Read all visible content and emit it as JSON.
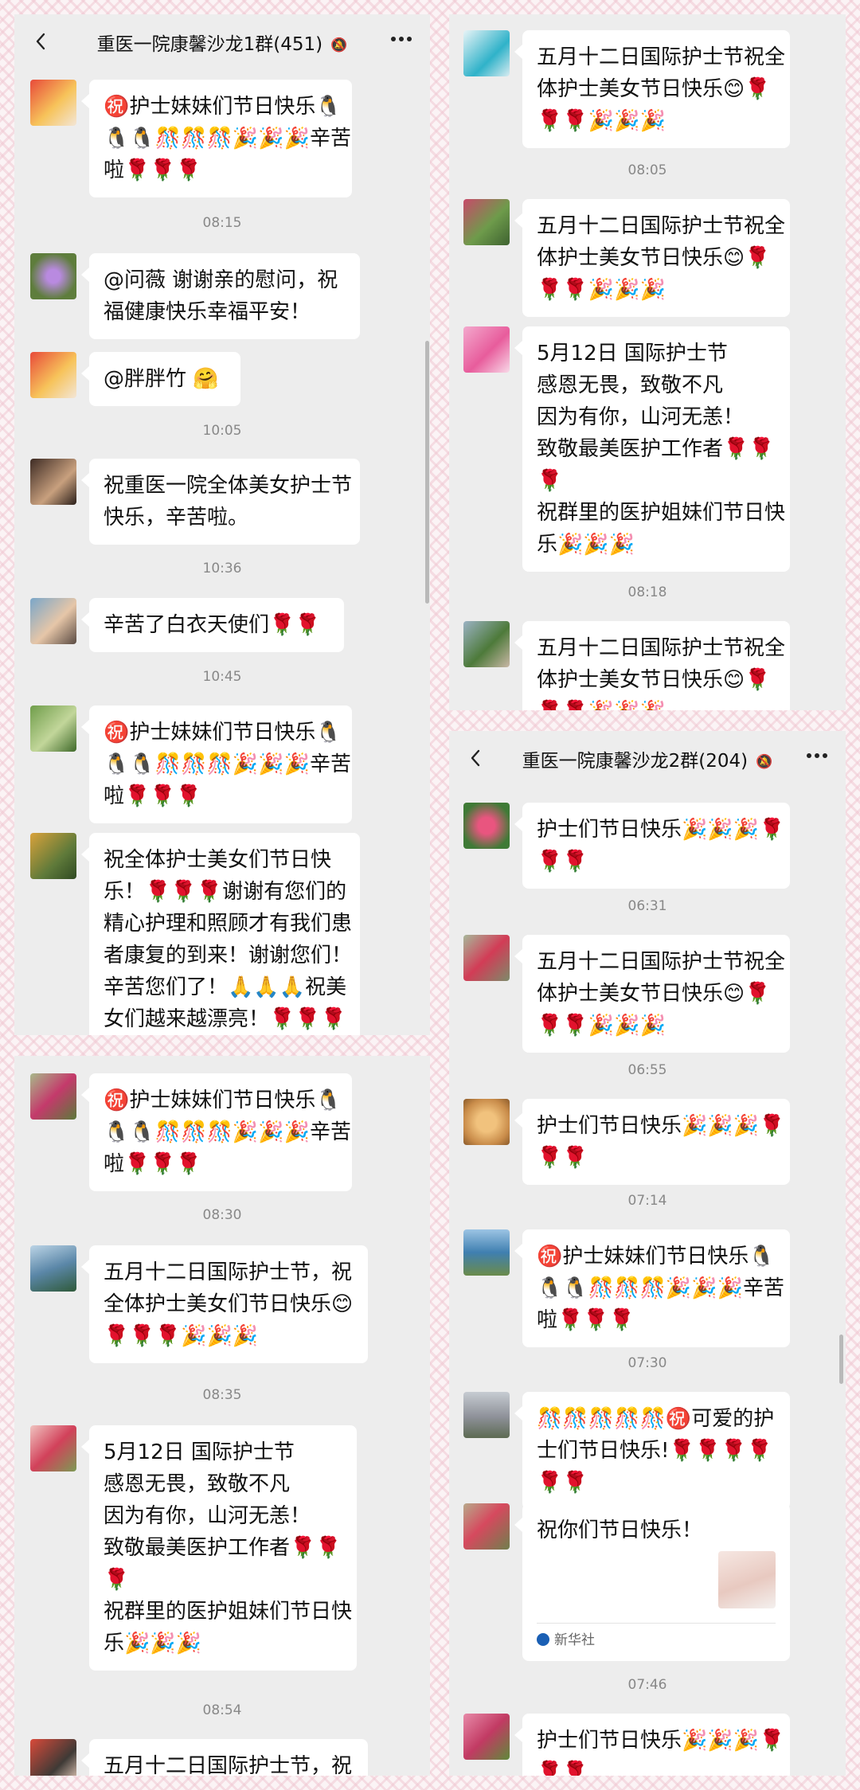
{
  "chat1": {
    "title": "重医一院康馨沙龙1群(451)",
    "messages": [
      {
        "lines": [
          "㊗️护士妹妹们节日快乐🐧",
          "🐧🐧🎊🎊🎊🎉🎉🎉辛苦",
          "啦🌹🌹🌹"
        ]
      },
      {
        "lines": [
          "@问薇  谢谢亲的慰问，祝",
          "福健康快乐幸福平安！"
        ]
      },
      {
        "lines": [
          "@胖胖竹  🤗"
        ]
      },
      {
        "lines": [
          "祝重医一院全体美女护士节",
          "快乐，辛苦啦。"
        ]
      },
      {
        "lines": [
          "辛苦了白衣天使们🌹🌹"
        ]
      },
      {
        "lines": [
          "㊗️护士妹妹们节日快乐🐧",
          "🐧🐧🎊🎊🎊🎉🎉🎉辛苦",
          "啦🌹🌹🌹"
        ]
      },
      {
        "lines": [
          "祝全体护士美女们节日快",
          "乐！🌹🌹🌹谢谢有您们的",
          "精心护理和照顾才有我们患",
          "者康复的到来！谢谢您们！",
          "辛苦您们了！🙏🙏🙏祝美",
          "女们越来越漂亮！🌹🌹🌹"
        ]
      }
    ],
    "times": [
      "08:15",
      "10:05",
      "10:36",
      "10:45"
    ]
  },
  "chat2": {
    "messages": [
      {
        "lines": [
          "五月十二日国际护士节祝全",
          "体护士美女节日快乐😊🌹",
          "🌹🌹🎉🎉🎉"
        ]
      },
      {
        "lines": [
          "五月十二日国际护士节祝全",
          "体护士美女节日快乐😊🌹",
          "🌹🌹🎉🎉🎉"
        ]
      },
      {
        "lines": [
          "5月12日 国际护士节",
          "感恩无畏，致敬不凡",
          "因为有你，山河无恙！",
          "致敬最美医护工作者🌹🌹",
          "🌹",
          "祝群里的医护姐妹们节日快",
          "乐🎉🎉🎉"
        ]
      },
      {
        "lines": [
          "五月十二日国际护士节祝全",
          "体护士美女节日快乐😊🌹",
          "🌹🌹🎉🎉🎉"
        ]
      }
    ],
    "times": [
      "08:05",
      "08:18"
    ]
  },
  "chat3": {
    "messages": [
      {
        "lines": [
          "㊗️护士妹妹们节日快乐🐧",
          "🐧🐧🎊🎊🎊🎉🎉🎉辛苦",
          "啦🌹🌹🌹"
        ]
      },
      {
        "lines": [
          "五月十二日国际护士节，祝",
          "全体护士美女们节日快乐😊",
          "🌹🌹🌹🎉🎉🎉"
        ]
      },
      {
        "lines": [
          "5月12日 国际护士节",
          "感恩无畏，致敬不凡",
          "因为有你，山河无恙！",
          "致敬最美医护工作者🌹🌹",
          "🌹",
          "祝群里的医护姐妹们节日快",
          "乐🎉🎉🎉"
        ]
      },
      {
        "lines": [
          "五月十二日国际护士节，祝"
        ]
      }
    ],
    "times": [
      "08:30",
      "08:35",
      "08:54"
    ]
  },
  "chat4": {
    "title": "重医一院康馨沙龙2群(204)",
    "messages": [
      {
        "lines": [
          "护士们节日快乐🎉🎉🎉🌹",
          "🌹🌹"
        ]
      },
      {
        "lines": [
          "五月十二日国际护士节祝全",
          "体护士美女节日快乐😊🌹",
          "🌹🌹🎉🎉🎉"
        ]
      },
      {
        "lines": [
          "护士们节日快乐🎉🎉🎉🌹",
          "🌹🌹"
        ]
      },
      {
        "lines": [
          "㊗️护士妹妹们节日快乐🐧",
          "🐧🐧🎊🎊🎊🎉🎉🎉辛苦",
          "啦🌹🌹🌹"
        ]
      },
      {
        "lines": [
          "🎊🎊🎊🎊🎊㊗️可爱的护",
          "士们节日快乐!🌹🌹🌹🌹",
          "🌹🌹"
        ]
      },
      {
        "card_title": "祝你们节日快乐！",
        "card_source": "新华社"
      },
      {
        "lines": [
          "护士们节日快乐🎉🎉🎉🌹",
          "🌹🌹"
        ]
      }
    ],
    "times": [
      "06:31",
      "06:55",
      "07:14",
      "07:30",
      "07:46"
    ]
  },
  "colors": {
    "chat_bg": "#ededed",
    "bubble_bg": "#ffffff",
    "time_text": "#888888",
    "page_pattern": "#f0c8d2"
  },
  "icons": {
    "back": "chevron-left-icon",
    "mute": "bell-off-icon",
    "more": "more-dots-icon"
  }
}
